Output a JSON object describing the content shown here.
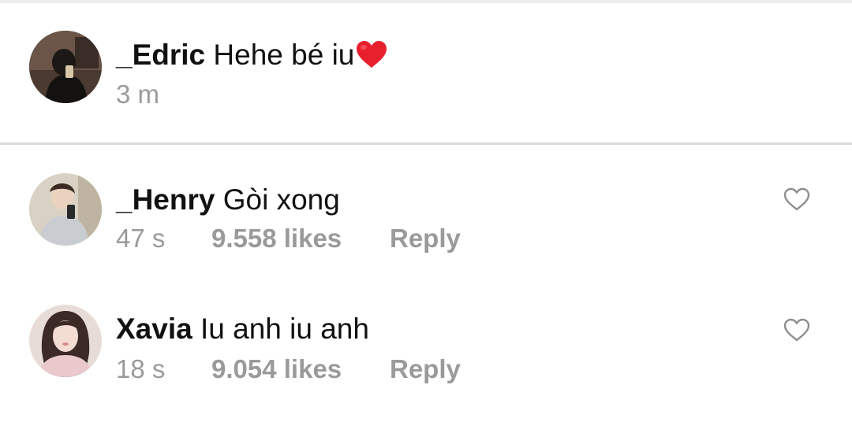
{
  "comments": [
    {
      "username": "_Edric",
      "text": "Hehe bé iu",
      "emoji": "red-heart",
      "time": "3 m"
    },
    {
      "username": "_Henry",
      "text": "Gòi xong",
      "time": "47 s",
      "likes": "9.558 likes",
      "reply_label": "Reply",
      "like_icon": "heart-outline-icon"
    },
    {
      "username": "Xavia",
      "text": "Iu anh iu anh",
      "time": "18 s",
      "likes": "9.054 likes",
      "reply_label": "Reply",
      "like_icon": "heart-outline-icon"
    }
  ],
  "colors": {
    "text": "#111111",
    "meta": "#9a9a9a",
    "divider": "#dcdcdc",
    "heart_emoji": "#e8202e",
    "like_outline": "#8e8e8e"
  }
}
